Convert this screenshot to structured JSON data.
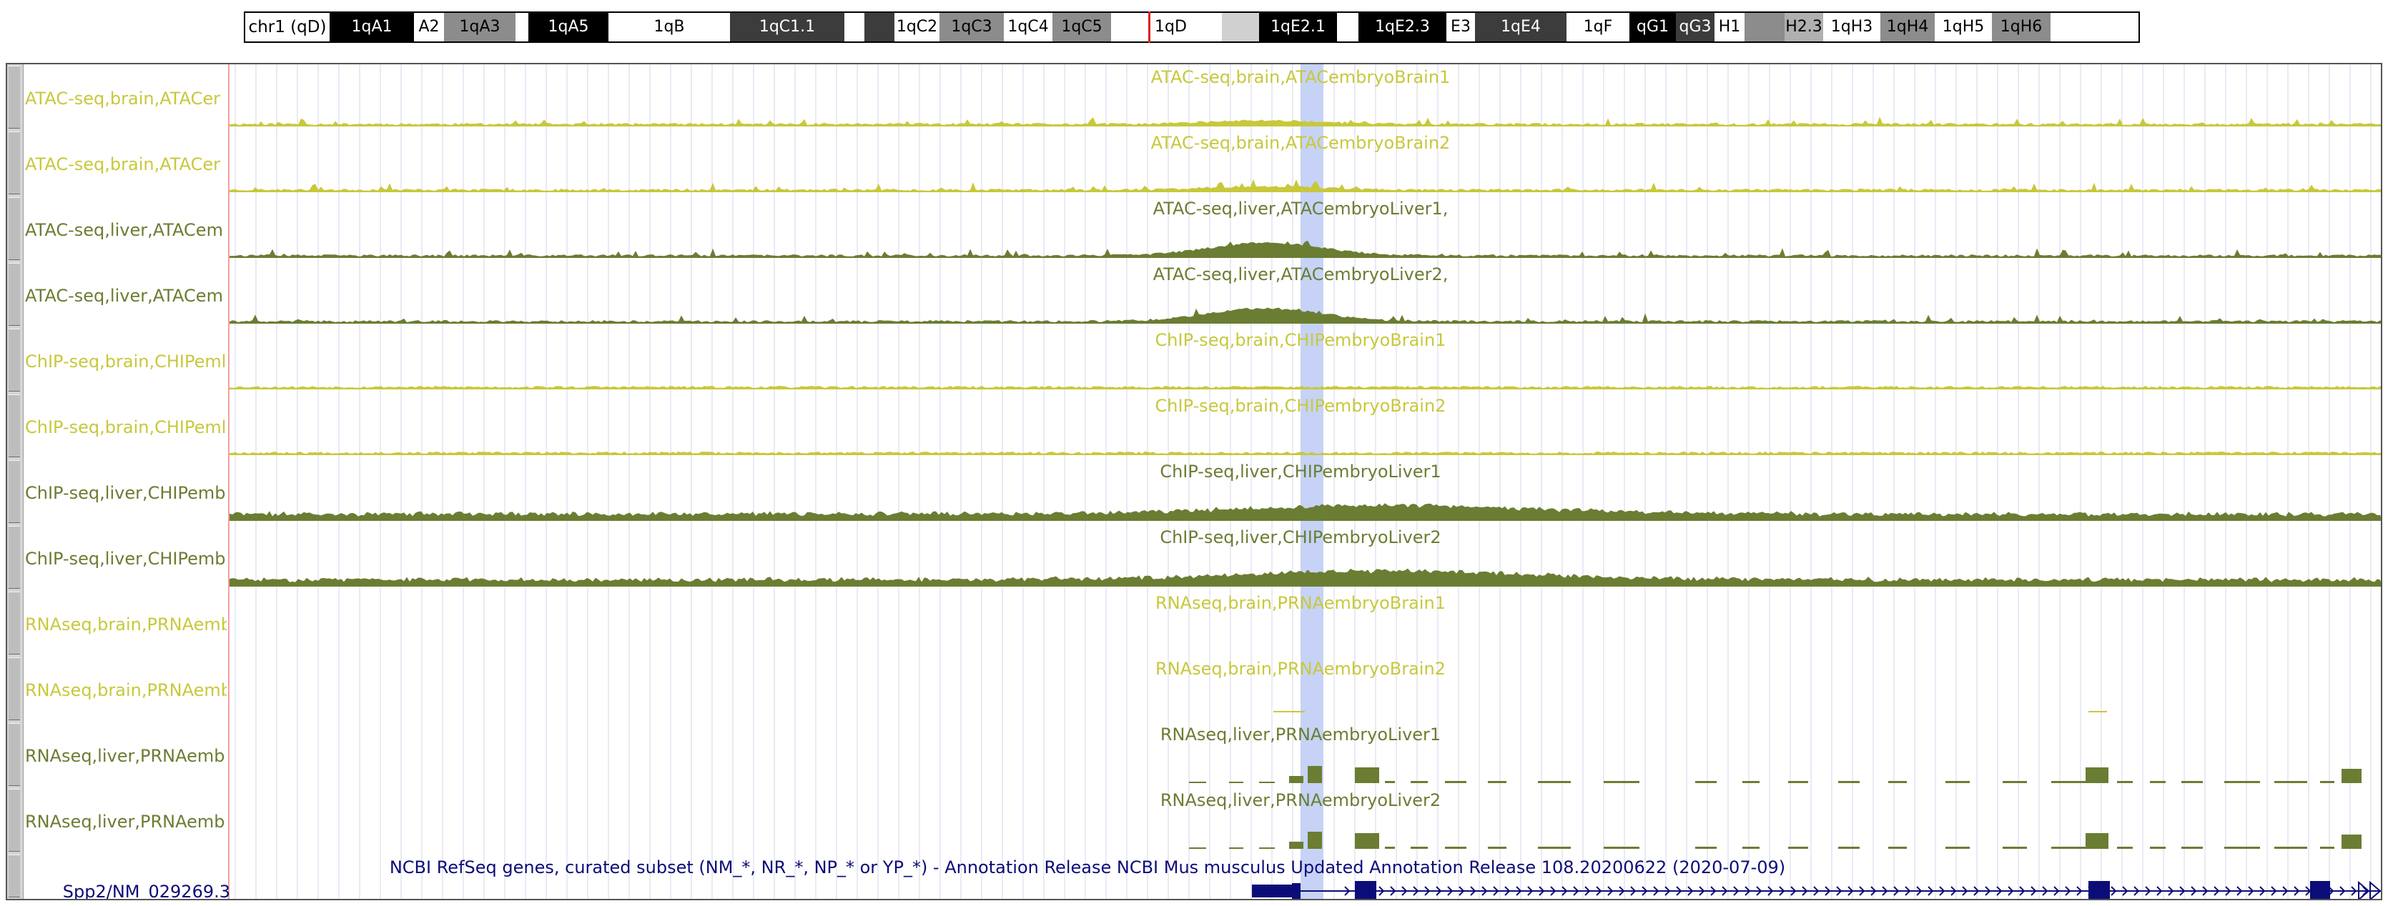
{
  "ideogram": {
    "chrom_label": "chr1 (qD)",
    "bands": [
      {
        "label": "1qA1",
        "bg": "#000000",
        "fg": "#ffffff",
        "w": 118
      },
      {
        "label": "A2",
        "bg": "#ffffff",
        "fg": "#000000",
        "w": 42
      },
      {
        "label": "1qA3",
        "bg": "#8c8c8c",
        "fg": "#000000",
        "w": 100
      },
      {
        "label": "",
        "bg": "#ffffff",
        "fg": "#000000",
        "w": 18
      },
      {
        "label": "1qA5",
        "bg": "#000000",
        "fg": "#ffffff",
        "w": 112
      },
      {
        "label": "1qB",
        "bg": "#ffffff",
        "fg": "#000000",
        "w": 170
      },
      {
        "label": "1qC1.1",
        "bg": "#3c3c3c",
        "fg": "#ffffff",
        "w": 160
      },
      {
        "label": "",
        "bg": "#ffffff",
        "fg": "#000000",
        "w": 28
      },
      {
        "label": "",
        "bg": "#3c3c3c",
        "fg": "#ffffff",
        "w": 42
      },
      {
        "label": "1qC2",
        "bg": "#ffffff",
        "fg": "#000000",
        "w": 63
      },
      {
        "label": "1qC3",
        "bg": "#8c8c8c",
        "fg": "#000000",
        "w": 90
      },
      {
        "label": "1qC4",
        "bg": "#ffffff",
        "fg": "#000000",
        "w": 68
      },
      {
        "label": "1qC5",
        "bg": "#8c8c8c",
        "fg": "#000000",
        "w": 82
      },
      {
        "label": "",
        "bg": "#ffffff",
        "fg": "#000000",
        "w": 12
      },
      {
        "label": "1qD",
        "bg": "#ffffff",
        "fg": "#000000",
        "w": 143
      },
      {
        "label": "",
        "bg": "#d0d0d0",
        "fg": "#000000",
        "w": 52
      },
      {
        "label": "1qE2.1",
        "bg": "#000000",
        "fg": "#ffffff",
        "w": 109
      },
      {
        "label": "",
        "bg": "#ffffff",
        "fg": "#000000",
        "w": 30
      },
      {
        "label": "1qE2.3",
        "bg": "#000000",
        "fg": "#ffffff",
        "w": 123
      },
      {
        "label": "E3",
        "bg": "#ffffff",
        "fg": "#000000",
        "w": 40
      },
      {
        "label": "1qE4",
        "bg": "#3c3c3c",
        "fg": "#ffffff",
        "w": 128
      },
      {
        "label": "1qF",
        "bg": "#ffffff",
        "fg": "#000000",
        "w": 88
      },
      {
        "label": "qG1",
        "bg": "#000000",
        "fg": "#ffffff",
        "w": 65
      },
      {
        "label": "qG3",
        "bg": "#3c3c3c",
        "fg": "#ffffff",
        "w": 54
      },
      {
        "label": "H1",
        "bg": "#ffffff",
        "fg": "#000000",
        "w": 42
      },
      {
        "label": "",
        "bg": "#8c8c8c",
        "fg": "#000000",
        "w": 56
      },
      {
        "label": "H2.3",
        "bg": "#b0b0b0",
        "fg": "#000000",
        "w": 54
      },
      {
        "label": "1qH3",
        "bg": "#ffffff",
        "fg": "#000000",
        "w": 80
      },
      {
        "label": "1qH4",
        "bg": "#8c8c8c",
        "fg": "#000000",
        "w": 76
      },
      {
        "label": "1qH5",
        "bg": "#ffffff",
        "fg": "#000000",
        "w": 80
      },
      {
        "label": "1qH6",
        "bg": "#8c8c8c",
        "fg": "#000000",
        "w": 82
      }
    ]
  },
  "colors": {
    "brain": "#c8c83c",
    "liver": "#6b7d32",
    "highlight": "#c6d3f6",
    "gene": "#0c0c78",
    "gridline": "#d4d4ec"
  },
  "tracks": [
    {
      "label": "ATAC-seq,brain,ATACer",
      "center": "ATAC-seq,brain,ATACembryoBrain1",
      "tissue": "brain",
      "kind": "atac",
      "seed": 11
    },
    {
      "label": "ATAC-seq,brain,ATACer",
      "center": "ATAC-seq,brain,ATACembryoBrain2",
      "tissue": "brain",
      "kind": "atac",
      "seed": 23
    },
    {
      "label": "ATAC-seq,liver,ATACem",
      "center": "ATAC-seq,liver,ATACembryoLiver1,",
      "tissue": "liver",
      "kind": "atac",
      "seed": 37
    },
    {
      "label": "ATAC-seq,liver,ATACem",
      "center": "ATAC-seq,liver,ATACembryoLiver2,",
      "tissue": "liver",
      "kind": "atac",
      "seed": 41
    },
    {
      "label": "ChIP-seq,brain,CHIPeml",
      "center": "ChIP-seq,brain,CHIPembryoBrain1",
      "tissue": "brain",
      "kind": "chip",
      "seed": 53
    },
    {
      "label": "ChIP-seq,brain,CHIPeml",
      "center": "ChIP-seq,brain,CHIPembryoBrain2",
      "tissue": "brain",
      "kind": "chip",
      "seed": 67
    },
    {
      "label": "ChIP-seq,liver,CHIPemb",
      "center": "ChIP-seq,liver,CHIPembryoLiver1",
      "tissue": "liver",
      "kind": "chip",
      "seed": 71
    },
    {
      "label": "ChIP-seq,liver,CHIPemb",
      "center": "ChIP-seq,liver,CHIPembryoLiver2",
      "tissue": "liver",
      "kind": "chip",
      "seed": 83
    },
    {
      "label": "RNAseq,brain,PRNAemb",
      "center": "RNAseq,brain,PRNAembryoBrain1",
      "tissue": "brain",
      "kind": "rna",
      "seed": 97
    },
    {
      "label": "RNAseq,brain,PRNAemb",
      "center": "RNAseq,brain,PRNAembryoBrain2",
      "tissue": "brain",
      "kind": "rna",
      "seed": 101
    },
    {
      "label": "RNAseq,liver,PRNAemb",
      "center": "RNAseq,liver,PRNAembryoLiver1",
      "tissue": "liver",
      "kind": "rna",
      "seed": 113
    },
    {
      "label": "RNAseq,liver,PRNAemb",
      "center": "RNAseq,liver,PRNAembryoLiver2",
      "tissue": "liver",
      "kind": "rna",
      "seed": 127
    }
  ],
  "gene_track": {
    "center": "NCBI RefSeq genes, curated subset (NM_*, NR_*, NP_* or YP_*) - Annotation Release NCBI Mus musculus Updated Annotation Release 108.20200622 (2020-07-09)",
    "gene_name": "Spp2/NM_029269.3"
  }
}
